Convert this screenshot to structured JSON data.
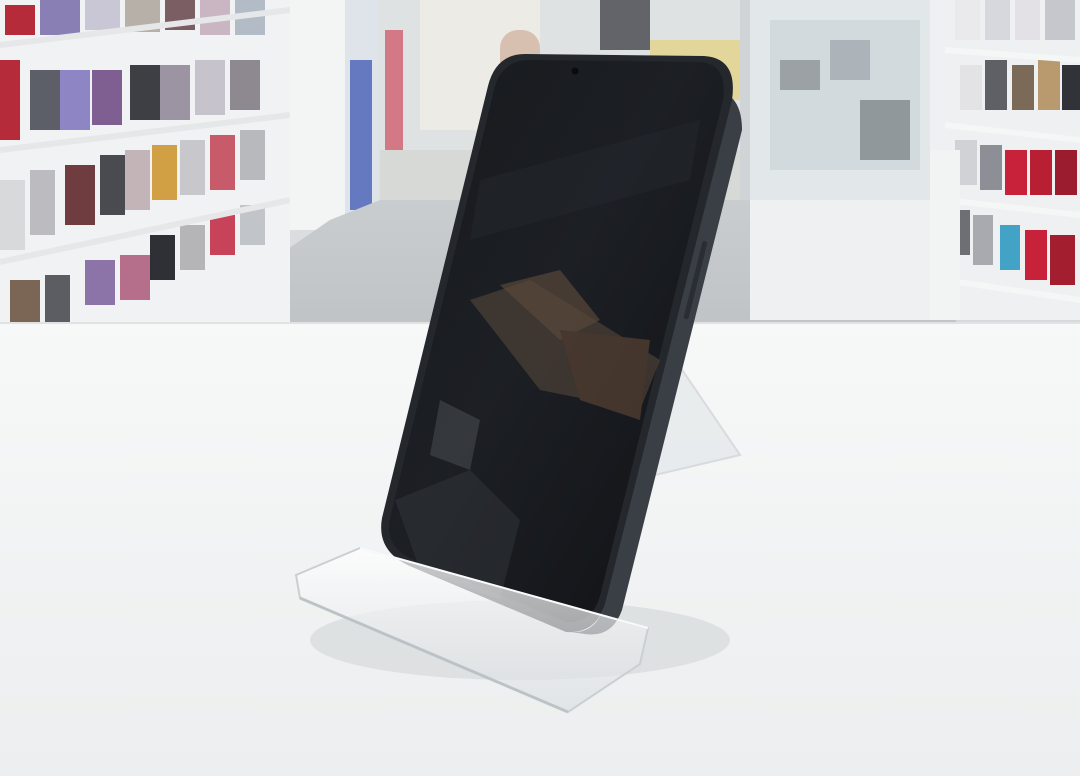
{
  "photo": {
    "subject": "smartphone-on-display-stand",
    "colors": {
      "counter": "#f6f7f7",
      "phone_body": "#1a1d22",
      "screen": "#121418",
      "floor": "#cfd3d4",
      "shelf_white": "#f2f3f3",
      "accent_red": "#c8223a",
      "accent_blue": "#4f66b8"
    }
  }
}
